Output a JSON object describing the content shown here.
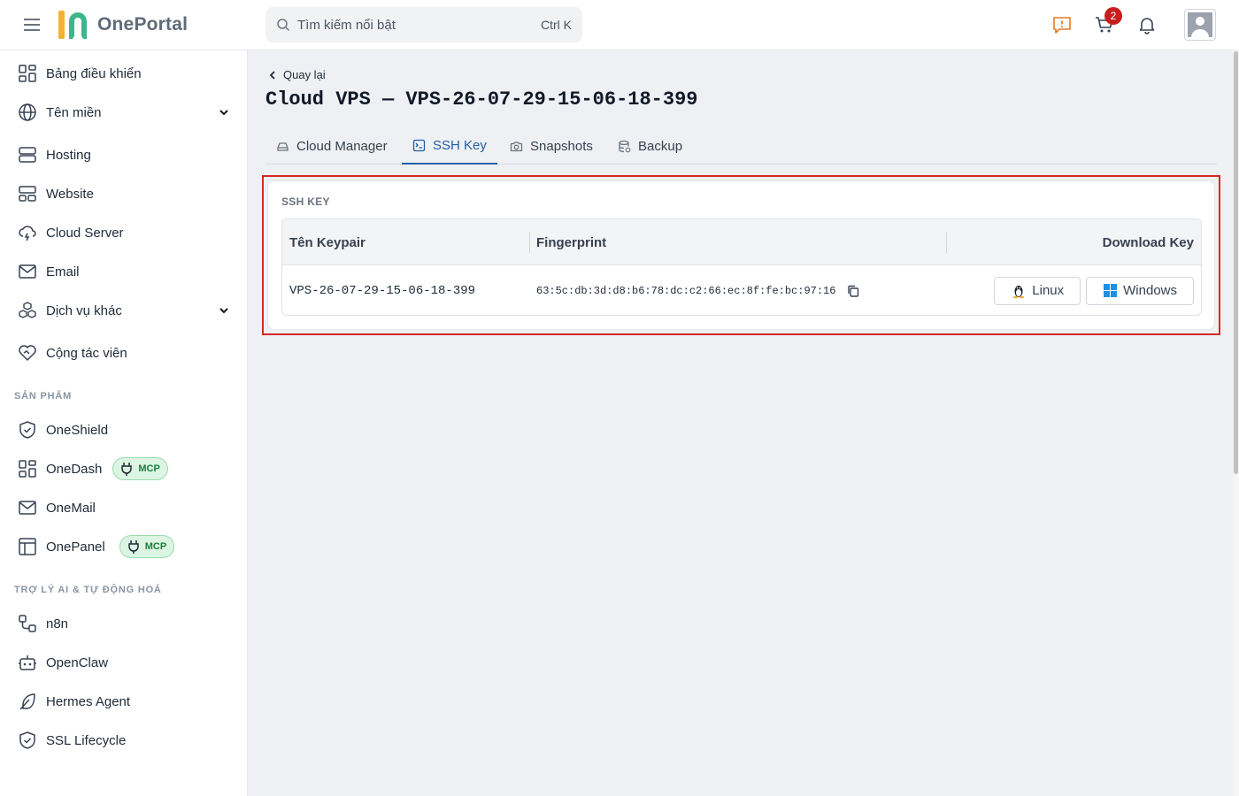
{
  "header": {
    "logo_text": "OnePortal",
    "search_placeholder": "Tìm kiếm nổi bật",
    "search_shortcut": "Ctrl K",
    "cart_count": "2"
  },
  "sidebar": {
    "items": [
      {
        "label": "Bảng điều khiển",
        "icon": "dashboard-icon"
      },
      {
        "label": "Tên miền",
        "icon": "globe-icon",
        "expandable": true
      },
      {
        "label": "Hosting",
        "icon": "server-icon"
      },
      {
        "label": "Website",
        "icon": "website-icon"
      },
      {
        "label": "Cloud Server",
        "icon": "cloud-icon"
      },
      {
        "label": "Email",
        "icon": "mail-icon"
      },
      {
        "label": "Dịch vụ khác",
        "icon": "boxes-icon",
        "expandable": true
      },
      {
        "label": "Cộng tác viên",
        "icon": "handshake-icon"
      }
    ],
    "products_title": "SẢN PHẨM",
    "products": [
      {
        "label": "OneShield",
        "icon": "shield-icon"
      },
      {
        "label": "OneDash",
        "icon": "dashboard-icon",
        "badge": "MCP"
      },
      {
        "label": "OneMail",
        "icon": "mail-icon"
      },
      {
        "label": "OnePanel",
        "icon": "panel-icon",
        "badge": "MCP"
      }
    ],
    "ai_title": "TRỢ LÝ AI & TỰ ĐỘNG HOÁ",
    "ai": [
      {
        "label": "n8n",
        "icon": "workflow-icon"
      },
      {
        "label": "OpenClaw",
        "icon": "bot-icon"
      },
      {
        "label": "Hermes Agent",
        "icon": "feather-icon"
      },
      {
        "label": "SSL Lifecycle",
        "icon": "shield-check-icon"
      }
    ]
  },
  "page": {
    "back_label": "Quay lại",
    "title": "Cloud VPS — VPS-26-07-29-15-06-18-399",
    "tabs": [
      {
        "label": "Cloud Manager",
        "icon": "hdd-icon"
      },
      {
        "label": "SSH Key",
        "icon": "terminal-icon",
        "active": true
      },
      {
        "label": "Snapshots",
        "icon": "camera-icon"
      },
      {
        "label": "Backup",
        "icon": "database-icon"
      }
    ]
  },
  "ssh": {
    "section_title": "SSH KEY",
    "columns": [
      "Tên Keypair",
      "Fingerprint",
      "Download Key"
    ],
    "rows": [
      {
        "name": "VPS-26-07-29-15-06-18-399",
        "fingerprint": "63:5c:db:3d:d8:b6:78:dc:c2:66:ec:8f:fe:bc:97:16",
        "linux_label": "Linux",
        "windows_label": "Windows"
      }
    ]
  },
  "colors": {
    "accent": "#1f5fa8",
    "highlight": "#d62828",
    "badge": "#c81e1e",
    "mcp_bg": "#dcf5e3",
    "mcp_text": "#15803d"
  }
}
